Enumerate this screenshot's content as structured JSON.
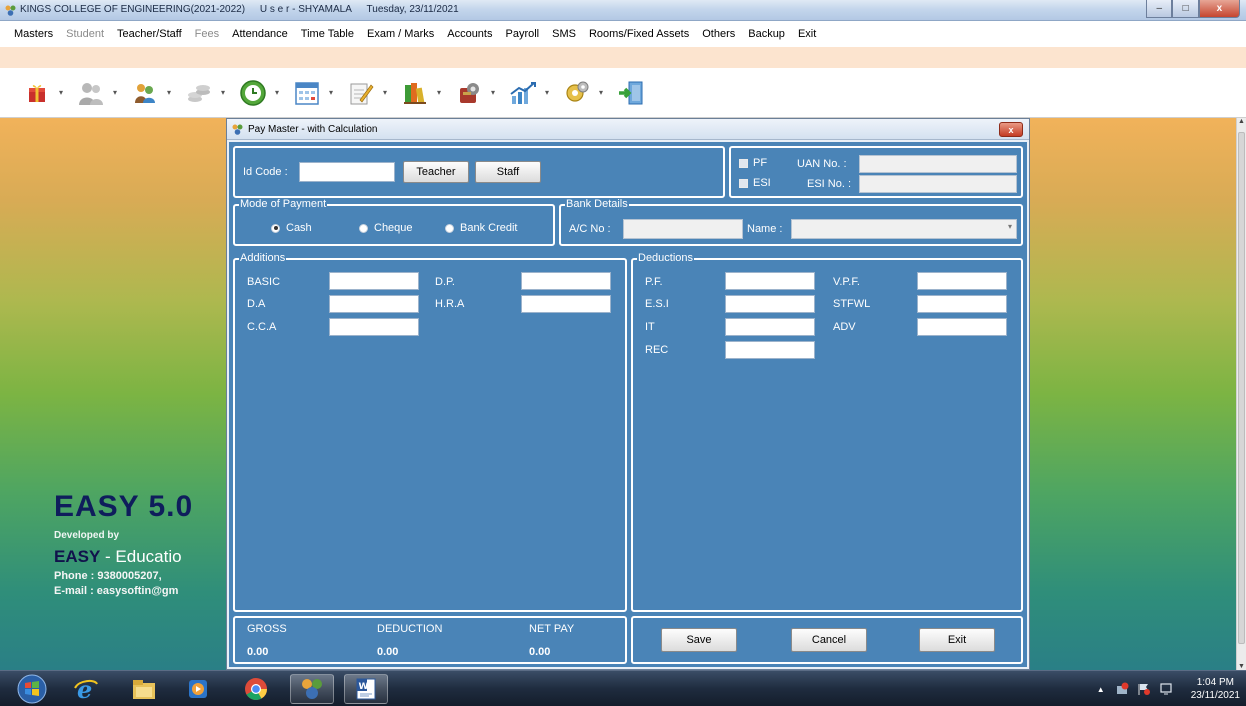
{
  "app": {
    "title": "KINGS COLLEGE OF ENGINEERING(2021-2022)",
    "user": "U s e r - SHYAMALA",
    "date": "Tuesday, 23/11/2021"
  },
  "menu": [
    {
      "label": "Masters",
      "enabled": true
    },
    {
      "label": "Student",
      "enabled": false
    },
    {
      "label": "Teacher/Staff",
      "enabled": true
    },
    {
      "label": "Fees",
      "enabled": false
    },
    {
      "label": "Attendance",
      "enabled": true
    },
    {
      "label": "Time Table",
      "enabled": true
    },
    {
      "label": "Exam / Marks",
      "enabled": true
    },
    {
      "label": "Accounts",
      "enabled": true
    },
    {
      "label": "Payroll",
      "enabled": true
    },
    {
      "label": "SMS",
      "enabled": true
    },
    {
      "label": "Rooms/Fixed Assets",
      "enabled": true
    },
    {
      "label": "Others",
      "enabled": true
    },
    {
      "label": "Backup",
      "enabled": true
    },
    {
      "label": "Exit",
      "enabled": true
    }
  ],
  "toolbar_icons": [
    "gift-icon",
    "users-icon",
    "teacher-icon",
    "coins-icon",
    "clock-icon",
    "calendar-icon",
    "pencil-notes-icon",
    "books-icon",
    "gear-bag-icon",
    "chart-icon",
    "tools-icon",
    "exit-door-icon"
  ],
  "background": {
    "brand": "EASY 5.0",
    "developed_by": "Developed by",
    "easy": "EASY",
    "easy_rest": " - Educatio",
    "phone": "Phone : 9380005207,",
    "email": "E-mail : easysoftin@gm"
  },
  "dialog": {
    "title": "Pay Master - with Calculation",
    "close": "x",
    "id_code_label": "Id Code :",
    "id_code_value": "",
    "teacher_button": "Teacher",
    "staff_button": "Staff",
    "pf_label": "PF",
    "esi_label": "ESI",
    "uan_label": "UAN No. :",
    "esi_no_label": "ESI No. :",
    "mode_legend": "Mode of Payment",
    "mode_options": [
      "Cash",
      "Cheque",
      "Bank Credit"
    ],
    "mode_selected": "Cash",
    "bank_legend": "Bank Details",
    "ac_label": "A/C No :",
    "name_label": "Name :",
    "additions_legend": "Additions",
    "additions": [
      "BASIC",
      "D.A",
      "C.C.A",
      "D.P.",
      "H.R.A"
    ],
    "deductions_legend": "Deductions",
    "deductions": [
      "P.F.",
      "E.S.I",
      "IT",
      "REC",
      "V.P.F.",
      "STFWL",
      "ADV"
    ],
    "gross_label": "GROSS",
    "deduction_label": "DEDUCTION",
    "netpay_label": "NET PAY",
    "gross_value": "0.00",
    "deduction_value": "0.00",
    "netpay_value": "0.00",
    "save_button": "Save",
    "cancel_button": "Cancel",
    "exit_button": "Exit"
  },
  "taskbar": {
    "time": "1:04 PM",
    "date": "23/11/2021"
  },
  "colors": {
    "dialog_body": "#4a84b7",
    "accent": "#2a7f86"
  }
}
